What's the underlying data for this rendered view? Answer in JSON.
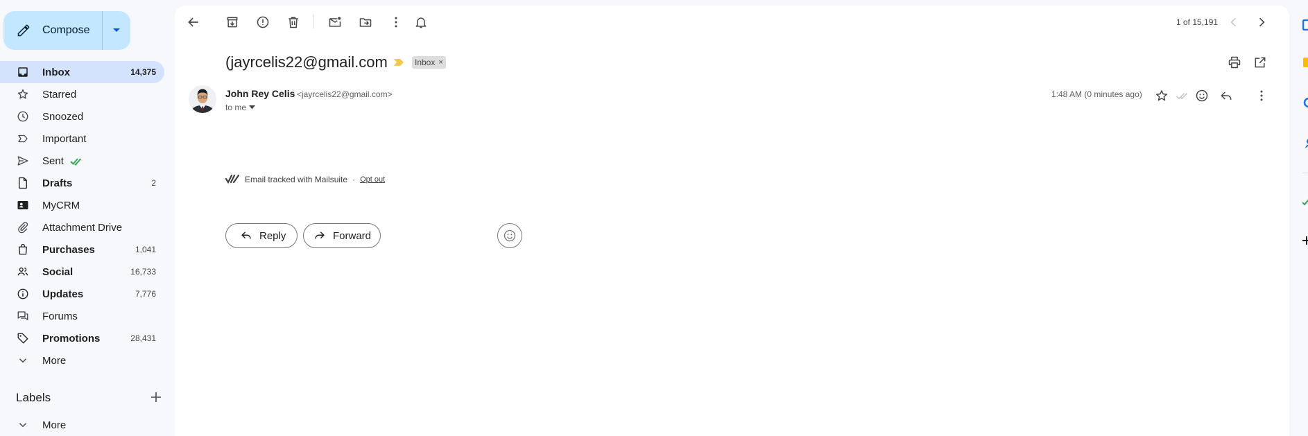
{
  "compose": {
    "label": "Compose"
  },
  "nav": [
    {
      "key": "inbox",
      "label": "Inbox",
      "count": "14,375",
      "bold": true,
      "active": true,
      "icon": "inbox-icon"
    },
    {
      "key": "starred",
      "label": "Starred",
      "count": "",
      "icon": "star-outline-icon"
    },
    {
      "key": "snoozed",
      "label": "Snoozed",
      "count": "",
      "icon": "clock-icon"
    },
    {
      "key": "important",
      "label": "Important",
      "count": "",
      "icon": "label-important-icon"
    },
    {
      "key": "sent",
      "label": "Sent",
      "count": "",
      "icon": "send-icon"
    },
    {
      "key": "drafts",
      "label": "Drafts",
      "count": "2",
      "bold": true,
      "icon": "draft-icon"
    },
    {
      "key": "mycrm",
      "label": "MyCRM",
      "count": "",
      "icon": "contact-card-icon"
    },
    {
      "key": "attachment-drive",
      "label": "Attachment Drive",
      "count": "",
      "icon": "paperclip-icon"
    },
    {
      "key": "purchases",
      "label": "Purchases",
      "count": "1,041",
      "bold": true,
      "icon": "shopping-bag-icon"
    },
    {
      "key": "social",
      "label": "Social",
      "count": "16,733",
      "bold": true,
      "icon": "people-icon"
    },
    {
      "key": "updates",
      "label": "Updates",
      "count": "7,776",
      "bold": true,
      "icon": "info-icon"
    },
    {
      "key": "forums",
      "label": "Forums",
      "count": "",
      "icon": "forum-icon"
    },
    {
      "key": "promotions",
      "label": "Promotions",
      "count": "28,431",
      "bold": true,
      "icon": "tag-icon"
    },
    {
      "key": "more",
      "label": "More",
      "count": "",
      "icon": "chevron-down-icon"
    }
  ],
  "labels": {
    "title": "Labels",
    "more_label": "More"
  },
  "toolbar": {
    "pager": "1 of 15,191"
  },
  "message": {
    "subject": "(jayrcelis22@gmail.com",
    "chip": "Inbox",
    "sender_name": "John Rey Celis",
    "sender_email": "<jayrcelis22@gmail.com>",
    "to": "to me",
    "time": "1:48 AM (0 minutes ago)"
  },
  "tracking": {
    "text": "Email tracked with Mailsuite",
    "separator": "·",
    "opt_out": "Opt out"
  },
  "actions": {
    "reply": "Reply",
    "forward": "Forward"
  },
  "colors": {
    "accent": "#c2e7ff",
    "active_nav": "#d3e3fd",
    "importance": "#f2c94c",
    "tracked_check": "#34a853"
  }
}
